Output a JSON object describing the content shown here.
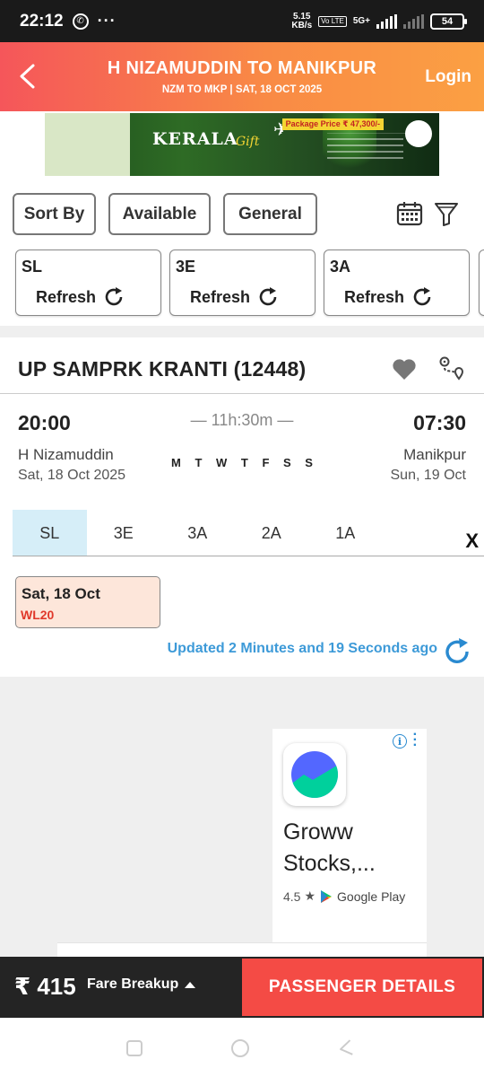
{
  "status_bar": {
    "time": "22:12",
    "more": "···",
    "speed_value": "5.15",
    "speed_unit": "KB/s",
    "volte": "Vo LTE",
    "network": "5G+",
    "battery": "54"
  },
  "header": {
    "title": "H NIZAMUDDIN TO MANIKPUR",
    "subtitle": "NZM TO MKP | SAT, 18 OCT  2025",
    "login_label": "Login"
  },
  "banner": {
    "title": "KERALA",
    "script": "Gift",
    "price": "Package Price ₹ 47,300/-"
  },
  "filters": {
    "sort_label": "Sort By",
    "available_label": "Available",
    "general_label": "General"
  },
  "quota_cards": [
    {
      "class": "SL",
      "refresh": "Refresh"
    },
    {
      "class": "3E",
      "refresh": "Refresh"
    },
    {
      "class": "3A",
      "refresh": "Refresh"
    }
  ],
  "train": {
    "name": "UP SAMPRK KRANTI (12448)",
    "dep_time": "20:00",
    "arr_time": "07:30",
    "duration": "— 11h:30m —",
    "dep_station": "H Nizamuddin",
    "dep_date": "Sat, 18 Oct  2025",
    "arr_station": "Manikpur",
    "arr_date": "Sun, 19 Oct",
    "run_days": "M T W T F S S",
    "classes": [
      "SL",
      "3E",
      "3A",
      "2A",
      "1A"
    ],
    "close_label": "X",
    "availability": {
      "date": "Sat, 18 Oct",
      "status": "WL20"
    },
    "updated_text": "Updated 2 Minutes and 19 Seconds ago"
  },
  "ad": {
    "name": "Groww Stocks,...",
    "rating": "4.5",
    "store": "Google Play"
  },
  "bottom_bar": {
    "fare": "₹ 415",
    "fare_breakup_label": "Fare Breakup",
    "passenger_button": "PASSENGER DETAILS"
  }
}
